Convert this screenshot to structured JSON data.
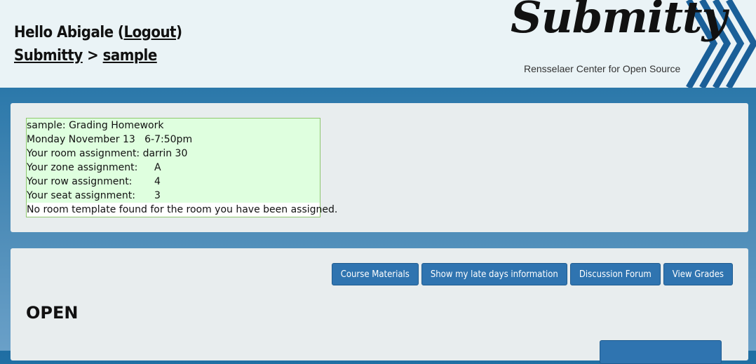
{
  "header": {
    "hello": "Hello Abigale (",
    "logout": "Logout",
    "close_paren": ")",
    "crumb_home": "Submitty",
    "crumb_sep": " > ",
    "crumb_course": "sample"
  },
  "logo": {
    "word": "Submitty",
    "subtitle": "Rensselaer Center for Open Source"
  },
  "seating": {
    "title": "sample: Grading Homework",
    "date": "Monday November 13   6-7:50pm",
    "room_label": "Your room assignment: ",
    "room_value": "darrin 30",
    "zone_label": "Your zone assignment:",
    "zone_value": "A",
    "row_label": "Your row assignment:",
    "row_value": "4",
    "seat_label": "Your seat assignment:",
    "seat_value": "3",
    "note": "No room template found for the room you have been assigned."
  },
  "nav_buttons": [
    "Course Materials",
    "Show my late days information",
    "Discussion Forum",
    "View Grades"
  ],
  "section": {
    "title": "OPEN"
  },
  "colors": {
    "accent": "#2f74b0",
    "header_bg": "#eaf3f6",
    "seat_bg": "#dfffdf"
  }
}
